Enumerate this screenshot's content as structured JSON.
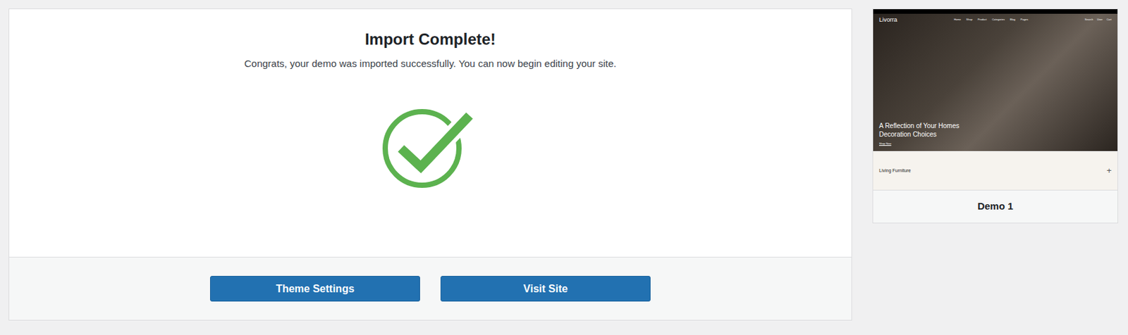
{
  "import": {
    "title": "Import Complete!",
    "message": "Congrats, your demo was imported successfully. You can now begin editing your site."
  },
  "buttons": [
    "Theme Settings",
    "Visit Site"
  ],
  "demo": {
    "name": "Demo 1",
    "preview": {
      "logo": "Livorra",
      "nav": [
        "Home",
        "Shop",
        "Product",
        "Categories",
        "Blog",
        "Pages"
      ],
      "actions": [
        "Search",
        "User",
        "Cart"
      ],
      "hero_title": "A Reflection of Your Homes Decoration Choices",
      "hero_button": "Shop Now",
      "section": "Living Furniture",
      "section_icon": "+"
    }
  }
}
